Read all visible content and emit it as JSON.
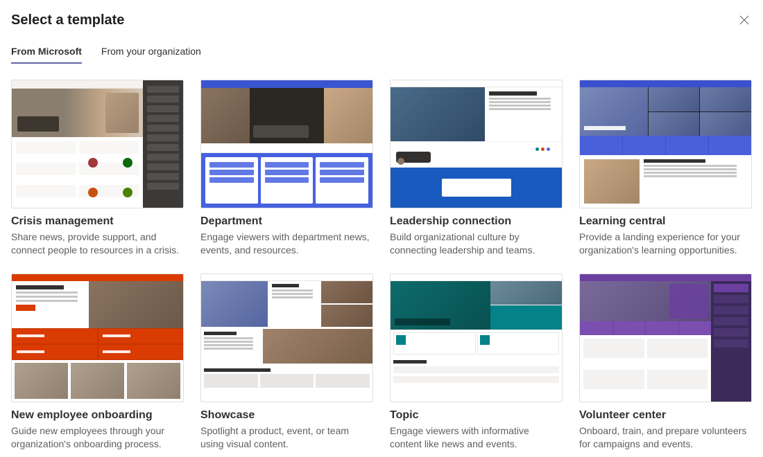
{
  "header": {
    "title": "Select a template"
  },
  "tabs": {
    "microsoft": "From Microsoft",
    "organization": "From your organization"
  },
  "templates": [
    {
      "id": "crisis-management",
      "title": "Crisis management",
      "description": "Share news, provide support, and connect people to resources in a crisis."
    },
    {
      "id": "department",
      "title": "Department",
      "description": "Engage viewers with department news, events, and resources."
    },
    {
      "id": "leadership-connection",
      "title": "Leadership connection",
      "description": "Build organizational culture by connecting leadership and teams."
    },
    {
      "id": "learning-central",
      "title": "Learning central",
      "description": "Provide a landing experience for your organization's learning opportunities."
    },
    {
      "id": "new-employee-onboarding",
      "title": "New employee onboarding",
      "description": "Guide new employees through your organization's onboarding process."
    },
    {
      "id": "showcase",
      "title": "Showcase",
      "description": "Spotlight a product, event, or team using visual content."
    },
    {
      "id": "topic",
      "title": "Topic",
      "description": "Engage viewers with informative content like news and events."
    },
    {
      "id": "volunteer-center",
      "title": "Volunteer center",
      "description": "Onboard, train, and prepare volunteers for campaigns and events."
    }
  ]
}
